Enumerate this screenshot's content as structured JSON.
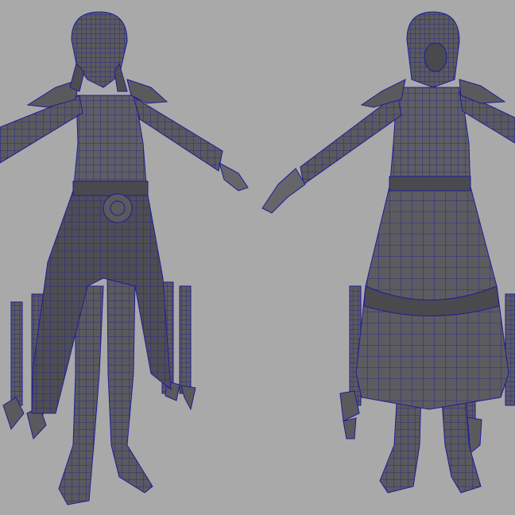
{
  "viewport": {
    "background": "#a9a9a9",
    "mesh_fill": "#5a5a5c",
    "mesh_shade": "#46464a",
    "mesh_light": "#727276",
    "wire_color": "#1c1c9c"
  },
  "models": [
    {
      "id": "front-view",
      "label": ""
    },
    {
      "id": "back-view",
      "label": ""
    }
  ]
}
